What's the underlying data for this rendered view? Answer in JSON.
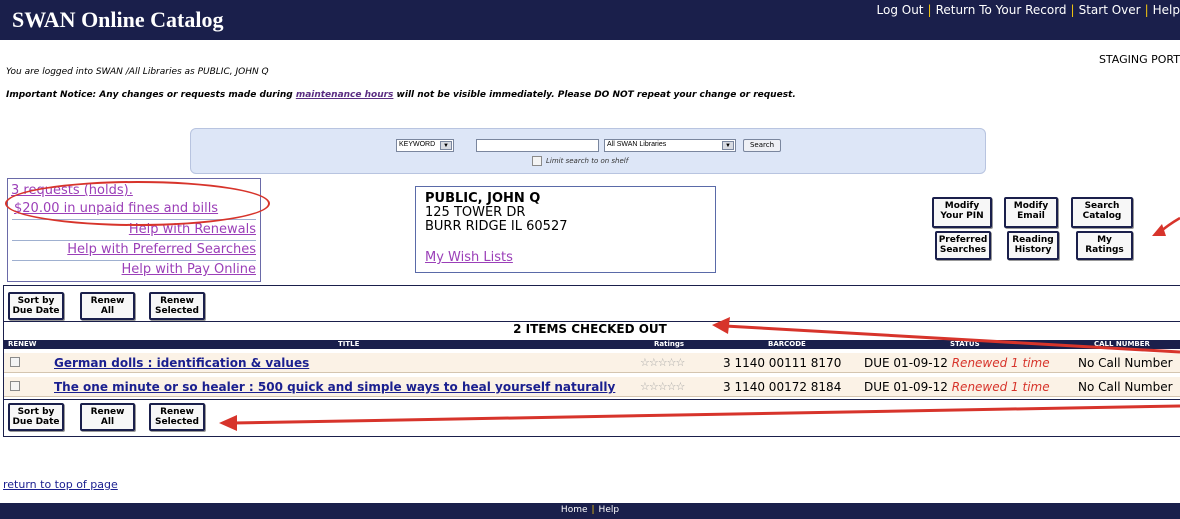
{
  "header": {
    "logo": "SWAN Online Catalog",
    "links": [
      "Log Out",
      "Return To Your Record",
      "Start Over",
      "Help"
    ]
  },
  "staging": "STAGING PORT",
  "logged_in": "You are logged into SWAN /All Libraries as PUBLIC, JOHN Q",
  "notice": {
    "before": "Important Notice: Any changes or requests made during ",
    "link": "maintenance hours",
    "after": " will not be visible immediately. Please DO NOT repeat your change or request."
  },
  "search": {
    "type": "KEYWORD",
    "scope": "All SWAN Libraries",
    "button": "Search",
    "limit_label": "Limit search to on shelf"
  },
  "account_links": {
    "requests": "3 requests (holds).",
    "fines": "$20.00 in unpaid fines and bills",
    "help_renewals": "Help with Renewals",
    "help_searches": "Help with Preferred Searches",
    "help_pay": "Help with Pay Online"
  },
  "patron": {
    "name": "PUBLIC, JOHN Q",
    "address1": "125 TOWER DR",
    "address2": "BURR RIDGE IL 60527",
    "wish_lists": "My Wish Lists"
  },
  "actions": {
    "modify_pin": [
      "Modify",
      "Your PIN"
    ],
    "modify_email": [
      "Modify",
      "Email"
    ],
    "search_catalog": [
      "Search",
      "Catalog"
    ],
    "preferred_searches": [
      "Preferred",
      "Searches"
    ],
    "reading_history": [
      "Reading",
      "History"
    ],
    "my_ratings": [
      "My",
      "Ratings"
    ]
  },
  "toolbar": {
    "sort": [
      "Sort by",
      "Due Date"
    ],
    "renew_all": [
      "Renew",
      "All"
    ],
    "renew_selected": [
      "Renew",
      "Selected"
    ]
  },
  "checkout": {
    "heading": "2 ITEMS CHECKED OUT",
    "columns": [
      "RENEW",
      "TITLE",
      "Ratings",
      "BARCODE",
      "STATUS",
      "CALL NUMBER"
    ],
    "rows": [
      {
        "title": "German dolls : identification & values",
        "stars": "☆☆☆☆☆",
        "barcode": "3 1140 00111 8170",
        "due": "DUE 01-09-12",
        "renewed": "Renewed 1 time",
        "call_number": "No Call Number"
      },
      {
        "title": "The one minute or so healer : 500 quick and simple ways to heal yourself naturally",
        "stars": "☆☆☆☆☆",
        "barcode": "3 1140 00172 8184",
        "due": "DUE 01-09-12",
        "renewed": "Renewed 1 time",
        "call_number": "No Call Number"
      }
    ]
  },
  "return_top": "return to top of page",
  "footer": [
    "Home",
    "Help"
  ],
  "colors": {
    "navy": "#1a1f4b",
    "accent_red": "#d7342b",
    "link_purple": "#9b3fb8"
  }
}
